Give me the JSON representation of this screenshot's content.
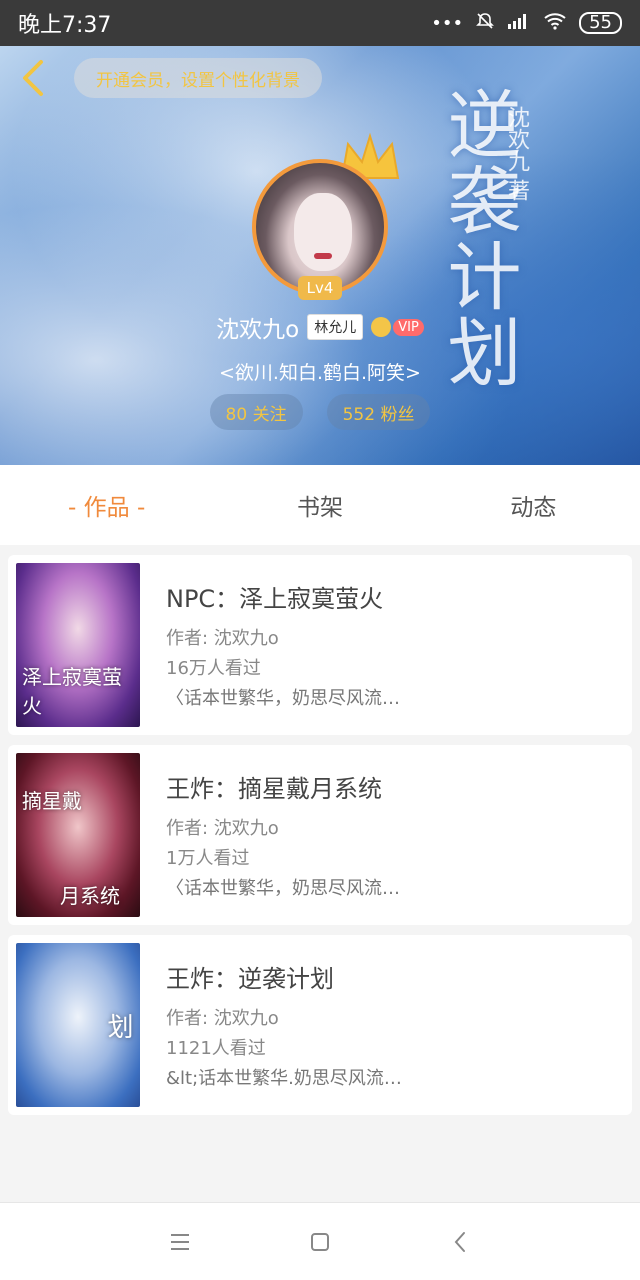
{
  "status_bar": {
    "time": "晚上7:37",
    "battery": "55",
    "icons": [
      "more-dots-icon",
      "bell-muted-icon",
      "signal-icon",
      "wifi-icon",
      "battery-icon"
    ]
  },
  "banner": {
    "promo": "开通会员，设置个性化背景",
    "cover_title": "逆袭计划",
    "cover_author": "沈欢九 著",
    "level": "Lv4",
    "user_name": "沈欢九o",
    "tag": "林允儿",
    "vip": "VIP",
    "group": "<欲川.知白.鹤白.阿笑>",
    "following": "80 关注",
    "followers": "552 粉丝"
  },
  "tabs": [
    {
      "label": "- 作品 -",
      "active": true
    },
    {
      "label": "书架",
      "active": false
    },
    {
      "label": "动态",
      "active": false
    }
  ],
  "books": [
    {
      "title": "NPC：泽上寂寞萤火",
      "author": "作者: 沈欢九o",
      "views": "16万人看过",
      "desc": "〈话本世繁华，奶思尽风流…",
      "cover_text": "泽上寂寞萤火"
    },
    {
      "title": "王炸：摘星戴月系统",
      "author": "作者: 沈欢九o",
      "views": "1万人看过",
      "desc": "〈话本世繁华，奶思尽风流…",
      "cover_text_top": "摘星戴",
      "cover_text": "月系统"
    },
    {
      "title": "王炸：逆袭计划",
      "author": "作者: 沈欢九o",
      "views": "1121人看过",
      "desc": "&lt;话本世繁华.奶思尽风流&…",
      "cover_text": "逆袭计划"
    }
  ],
  "colors": {
    "accent": "#f08a3c",
    "promo_text": "#f2c542",
    "level_badge": "#f0b94a"
  }
}
